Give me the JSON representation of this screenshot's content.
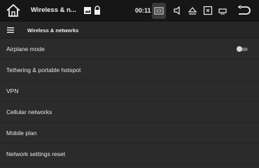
{
  "status_bar": {
    "title": "Wireless & n...",
    "time": "00:11",
    "icons": [
      "home-icon",
      "image-notification-icon",
      "lock-notification-icon",
      "screenshot-icon",
      "volume-icon",
      "eject-icon",
      "close-window-icon",
      "minimize-window-icon",
      "back-icon"
    ]
  },
  "toolbar": {
    "title": "Wireless & networks",
    "menu_icon": "hamburger-menu-icon"
  },
  "settings": {
    "items": [
      {
        "label": "Airplane mode",
        "toggle": "off"
      },
      {
        "label": "Tethering & portable hotspot"
      },
      {
        "label": "VPN"
      },
      {
        "label": "Cellular networks"
      },
      {
        "label": "Mobile plan"
      },
      {
        "label": "Network settings reset"
      }
    ]
  },
  "colors": {
    "statusbar_bg": "#161616",
    "toolbar_bg": "#262626",
    "list_bg": "#2b2b2b",
    "text": "#e8e8e8"
  }
}
